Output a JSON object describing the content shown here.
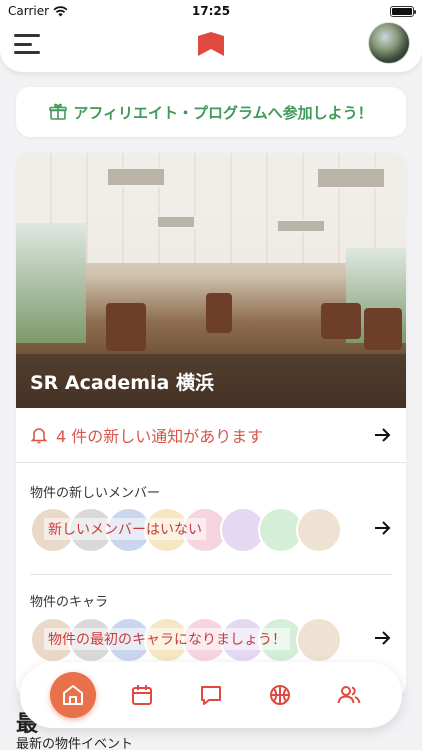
{
  "status_bar": {
    "carrier": "Carrier",
    "time": "17:25"
  },
  "colors": {
    "accent": "#e8704a",
    "brand_red": "#e0493f",
    "notice_red": "#d9574a",
    "affiliate_green": "#3f9a58"
  },
  "header": {
    "menu_icon": "hamburger-menu-icon",
    "logo_icon": "bookmark-logo-icon",
    "avatar": "user-avatar"
  },
  "affiliate": {
    "icon": "gift-icon",
    "label": "アフィリエイト・プログラムへ参加しよう！"
  },
  "property": {
    "name": "SR Academia 横浜",
    "notifications": {
      "icon": "bell-icon",
      "text": "4 件の新しい通知があります"
    },
    "members": {
      "label": "物件の新しいメンバー",
      "empty_text": "新しいメンバーはいない"
    },
    "characters": {
      "label": "物件のキャラ",
      "empty_text": "物件の最初のキャラになりましょう！"
    }
  },
  "latest": {
    "heading": "最",
    "subheading": "最新の物件イベント"
  },
  "bottom_nav": [
    {
      "icon": "home-icon",
      "active": true
    },
    {
      "icon": "calendar-icon",
      "active": false
    },
    {
      "icon": "chat-icon",
      "active": false
    },
    {
      "icon": "basketball-icon",
      "active": false
    },
    {
      "icon": "people-icon",
      "active": false
    }
  ]
}
